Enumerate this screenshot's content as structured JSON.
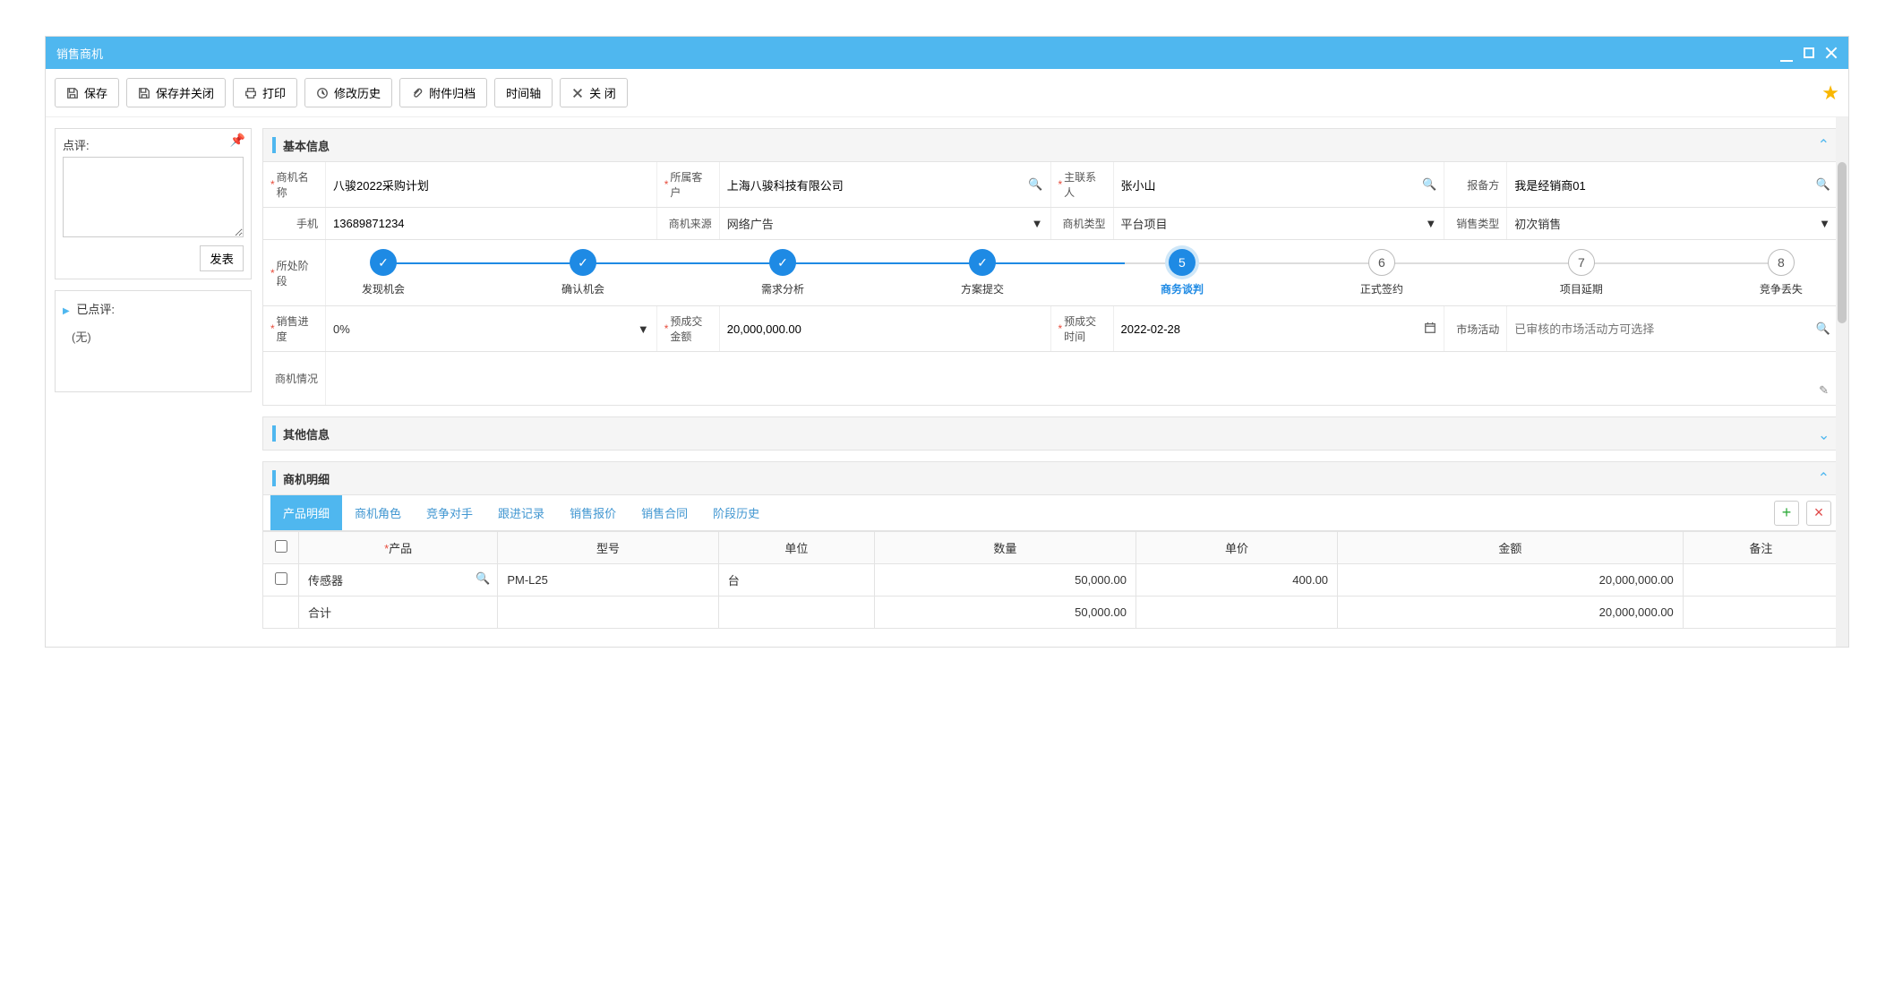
{
  "window": {
    "title": "销售商机"
  },
  "toolbar": {
    "save": "保存",
    "save_close": "保存并关闭",
    "print": "打印",
    "history": "修改历史",
    "attach": "附件归档",
    "timeline": "时间轴",
    "close": "关 闭"
  },
  "sidebar": {
    "comment_label": "点评:",
    "publish": "发表",
    "commented_label": "已点评:",
    "none": "(无)"
  },
  "sections": {
    "basic": "基本信息",
    "other": "其他信息",
    "detail": "商机明细"
  },
  "form": {
    "opp_name_label": "商机名称",
    "opp_name": "八骏2022采购计划",
    "customer_label": "所属客户",
    "customer": "上海八骏科技有限公司",
    "contact_label": "主联系人",
    "contact": "张小山",
    "reporter_label": "报备方",
    "reporter": "我是经销商01",
    "phone_label": "手机",
    "phone": "13689871234",
    "source_label": "商机来源",
    "source": "网络广告",
    "type_label": "商机类型",
    "type": "平台项目",
    "sale_type_label": "销售类型",
    "sale_type": "初次销售",
    "stage_label": "所处阶段",
    "progress_label": "销售进度",
    "progress": "0%",
    "expect_amount_label": "预成交金额",
    "expect_amount": "20,000,000.00",
    "expect_time_label": "预成交时间",
    "expect_time": "2022-02-28",
    "activity_label": "市场活动",
    "activity_placeholder": "已审核的市场活动方可选择",
    "situation_label": "商机情况"
  },
  "stages": [
    {
      "label": "发现机会",
      "state": "done"
    },
    {
      "label": "确认机会",
      "state": "done"
    },
    {
      "label": "需求分析",
      "state": "done"
    },
    {
      "label": "方案提交",
      "state": "done"
    },
    {
      "label": "商务谈判",
      "state": "current",
      "num": "5"
    },
    {
      "label": "正式签约",
      "state": "pending",
      "num": "6"
    },
    {
      "label": "项目延期",
      "state": "pending",
      "num": "7"
    },
    {
      "label": "竞争丢失",
      "state": "pending",
      "num": "8"
    }
  ],
  "tabs": {
    "product": "产品明细",
    "role": "商机角色",
    "competitor": "竞争对手",
    "follow": "跟进记录",
    "quote": "销售报价",
    "contract": "销售合同",
    "stage_history": "阶段历史"
  },
  "table": {
    "headers": {
      "product": "产品",
      "model": "型号",
      "unit": "单位",
      "qty": "数量",
      "price": "单价",
      "amount": "金额",
      "note": "备注"
    },
    "row": {
      "product": "传感器",
      "model": "PM-L25",
      "unit": "台",
      "qty": "50,000.00",
      "price": "400.00",
      "amount": "20,000,000.00",
      "note": ""
    },
    "total_label": "合计",
    "total_qty": "50,000.00",
    "total_amount": "20,000,000.00"
  }
}
